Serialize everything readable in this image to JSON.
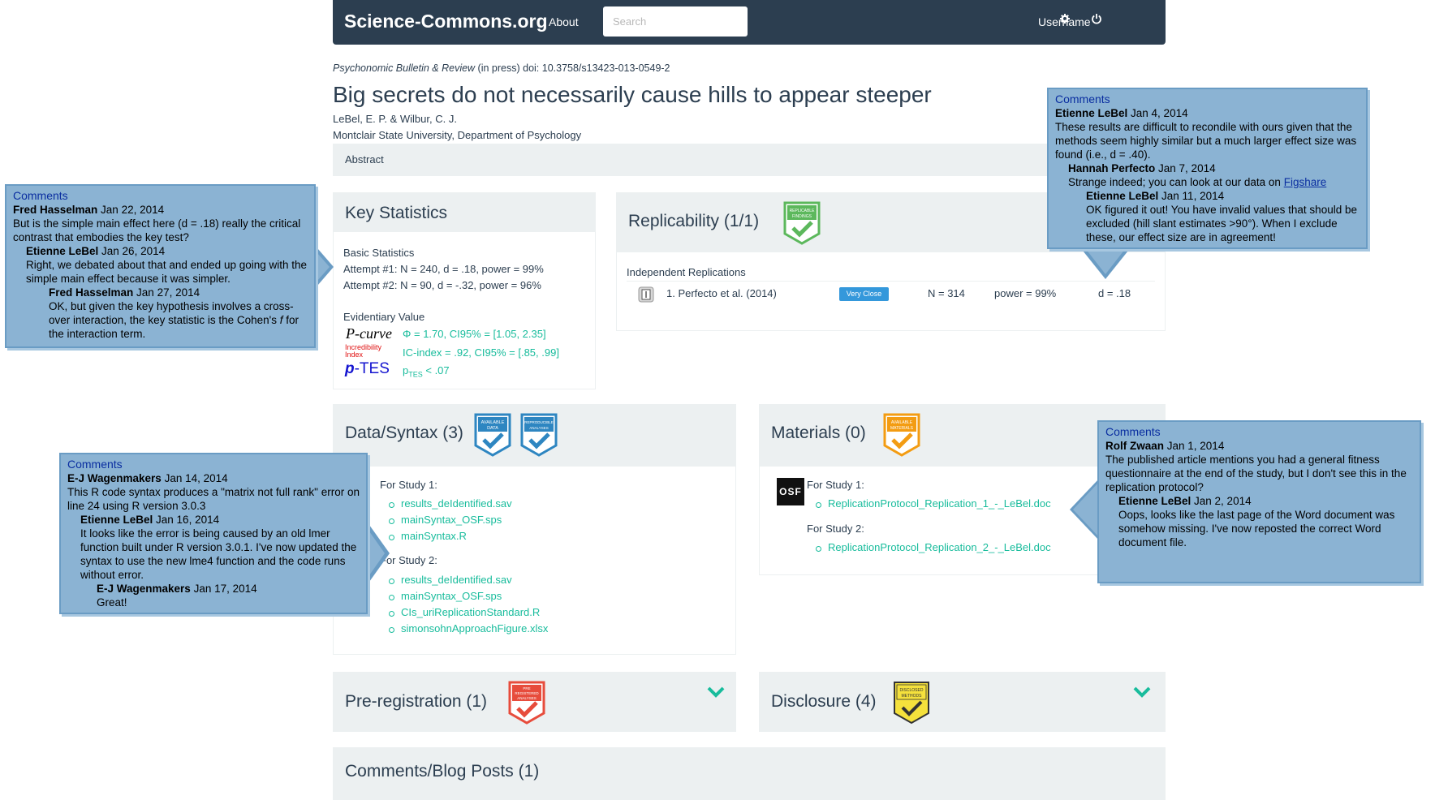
{
  "navbar": {
    "brand": "Science-Commons.org",
    "about": "About",
    "search_placeholder": "Search",
    "username": "Username",
    "settings_icon": "gear-icon",
    "power_icon": "power-icon"
  },
  "paper": {
    "journal": "Psychonomic Bulletin & Review",
    "citation_rest": " (in press) doi: 10.3758/s13423-013-0549-2",
    "title": "Big secrets do not necessarily cause hills to appear steeper",
    "authors": "LeBel, E. P. & Wilbur, C. J.",
    "affiliation": "Montclair State University, Department of Psychology",
    "abstract_label": "Abstract"
  },
  "key_statistics": {
    "title": "Key Statistics",
    "basic_label": "Basic Statistics",
    "attempt1": "Attempt #1:  N = 240,  d = .18,  power = 99%",
    "attempt2": "Attempt #2:  N = 90,  d = -.32,  power = 96%",
    "evidentiary_label": "Evidentiary Value",
    "pcurve_logo": "P-curve",
    "pcurve_value": "Φ = 1.70, CI95% = [1.05, 2.35]",
    "ic_logo_line1": "Incredibility",
    "ic_logo_line2": "Index",
    "ic_value": "IC-index = .92, CI95% = [.85, .99]",
    "ptes_logo_p": "p",
    "ptes_logo_rest": "-TES",
    "ptes_value": "p",
    "ptes_sub": "TES",
    "ptes_rest": " < .07"
  },
  "replicability": {
    "title": "Replicability (1/1)",
    "badge_text": "REPLICABLE FINDINGS",
    "independent_label": "Independent Replications",
    "row_label": "1. Perfecto et al. (2014)",
    "row_badge": "Very Close",
    "row_n": "N = 314",
    "row_power": "power = 99%",
    "row_d": "d = .18"
  },
  "data_syntax": {
    "title": "Data/Syntax (3)",
    "badge1": "AVAILABLE DATA",
    "badge2": "REPRODUCIBLE ANALYSES",
    "study1_label": "For Study 1:",
    "study1_files": [
      "results_deIdentified.sav",
      "mainSyntax_OSF.sps",
      "mainSyntax.R"
    ],
    "study2_label": "For Study 2:",
    "study2_files": [
      "results_deIdentified.sav",
      "mainSyntax_OSF.sps",
      "CIs_uriReplicationStandard.R",
      "simonsohnApproachFigure.xlsx"
    ]
  },
  "materials": {
    "title": "Materials (0)",
    "badge": "AVAILABLE MATERIALS",
    "study1_label": "For Study 1:",
    "study1_files": [
      "ReplicationProtocol_Replication_1_-_LeBel.doc"
    ],
    "study2_label": "For Study 2:",
    "study2_files": [
      "ReplicationProtocol_Replication_2_-_LeBel.doc"
    ],
    "osf_logo": "OSF"
  },
  "preregistration": {
    "title": "Pre-registration (1)",
    "badge": "PRE REGISTERED ANALYSES"
  },
  "disclosure": {
    "title": "Disclosure (4)",
    "badge": "DISCLOSED METHODS"
  },
  "comments_blog": {
    "title": "Comments/Blog Posts (1)"
  },
  "callouts": {
    "left_top": {
      "header": "Comments",
      "c1_author": "Fred Hasselman",
      "c1_date": " Jan 22, 2014",
      "c1_text": "But is the simple main effect here (d = .18) really the critical contrast that embodies the key test?",
      "c2_author": "Etienne LeBel",
      "c2_date": " Jan 26, 2014",
      "c2_text": "Right, we debated about that and ended up going with the simple main effect because it was simpler.",
      "c3_author": "Fred Hasselman",
      "c3_date": " Jan 27, 2014",
      "c3_text1": "OK, but given the key hypothesis involves a cross-over interaction, the key statistic is the Cohen's ",
      "c3_f": "f",
      "c3_text2": " for the interaction term."
    },
    "left_bottom": {
      "header": "Comments",
      "c1_author": "E-J Wagenmakers",
      "c1_date": " Jan 14, 2014",
      "c1_text": "This R code syntax produces a \"matrix not full rank\" error on line 24 using R version 3.0.3",
      "c2_author": "Etienne LeBel",
      "c2_date": " Jan 16, 2014",
      "c2_text": "It looks like the error is being caused by an old lmer function built under R version 3.0.1. I've now updated the syntax to use the new lme4 function and the code runs without error.",
      "c3_author": "E-J Wagenmakers",
      "c3_date": " Jan 17, 2014",
      "c3_text": "Great!"
    },
    "right_top": {
      "header": "Comments",
      "c1_author": "Etienne LeBel",
      "c1_date": " Jan 4, 2014",
      "c1_text": "These results are difficult to recondile with ours given that the methods seem highly similar but a much larger effect size was found (i.e., d = .40).",
      "c2_author": "Hannah Perfecto",
      "c2_date": " Jan 7, 2014",
      "c2_text": "Strange indeed; you can look at our data on ",
      "c2_link": "Figshare",
      "c3_author": "Etienne LeBel",
      "c3_date": " Jan 11, 2014",
      "c3_text": "OK figured it out! You have invalid values that should be excluded (hill slant estimates >90°). When I exclude these, our effect size are in agreement!"
    },
    "right_bottom": {
      "header": "Comments",
      "c1_author": "Rolf Zwaan",
      "c1_date": " Jan 1, 2014",
      "c1_text": "The published article mentions you had a general fitness questionnaire at the end of the study, but I don't see this in the replication protocol?",
      "c2_author": "Etienne LeBel",
      "c2_date": " Jan 2, 2014",
      "c2_text": "Oops, looks like the last page of the Word document was somehow missing. I've now reposted the correct Word document file."
    }
  }
}
